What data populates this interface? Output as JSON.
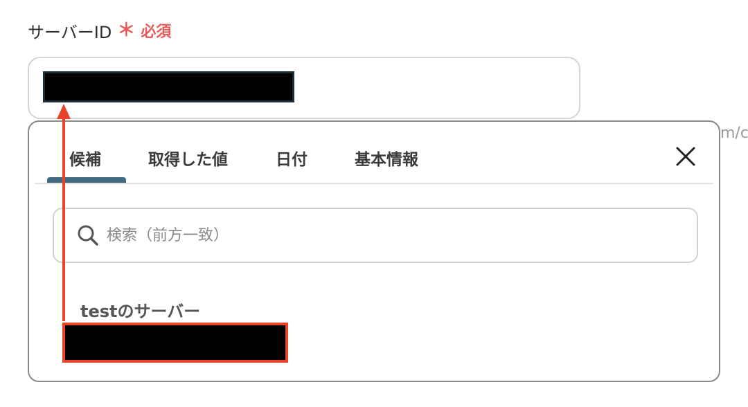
{
  "field": {
    "label": "サーバーID",
    "required_mark": "＊",
    "required_text": "必須"
  },
  "background_fragment": "m/c",
  "popup": {
    "tabs": [
      {
        "label": "候補",
        "active": true
      },
      {
        "label": "取得した値",
        "active": false
      },
      {
        "label": "日付",
        "active": false
      },
      {
        "label": "基本情報",
        "active": false
      }
    ],
    "search": {
      "placeholder": "検索（前方一致）",
      "icon": "search-icon"
    },
    "candidate_group_label": "testのサーバー",
    "close_icon": "close-icon"
  },
  "colors": {
    "required": "#e65b5b",
    "active_tab": "#3f6a80",
    "annotation": "#e8442a"
  }
}
